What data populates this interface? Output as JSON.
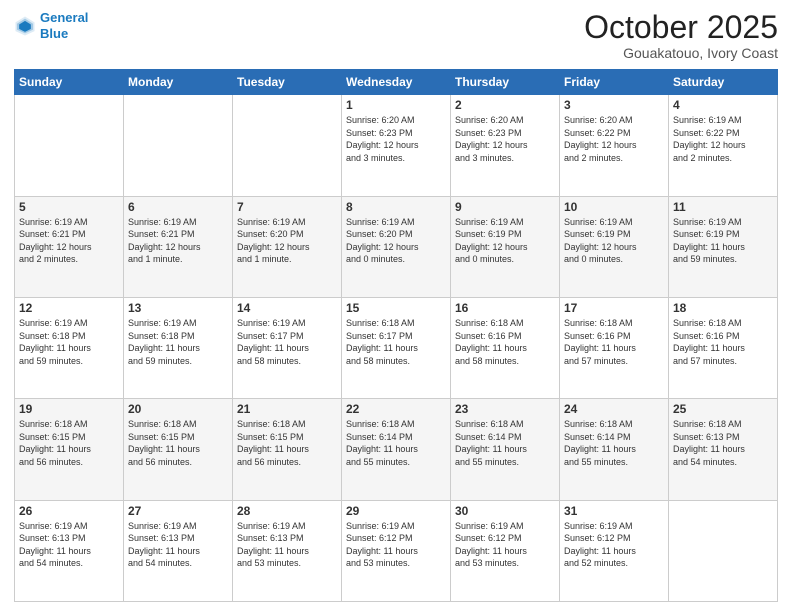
{
  "header": {
    "logo_line1": "General",
    "logo_line2": "Blue",
    "month": "October 2025",
    "location": "Gouakatouo, Ivory Coast"
  },
  "weekdays": [
    "Sunday",
    "Monday",
    "Tuesday",
    "Wednesday",
    "Thursday",
    "Friday",
    "Saturday"
  ],
  "weeks": [
    [
      {
        "day": "",
        "info": ""
      },
      {
        "day": "",
        "info": ""
      },
      {
        "day": "",
        "info": ""
      },
      {
        "day": "1",
        "info": "Sunrise: 6:20 AM\nSunset: 6:23 PM\nDaylight: 12 hours\nand 3 minutes."
      },
      {
        "day": "2",
        "info": "Sunrise: 6:20 AM\nSunset: 6:23 PM\nDaylight: 12 hours\nand 3 minutes."
      },
      {
        "day": "3",
        "info": "Sunrise: 6:20 AM\nSunset: 6:22 PM\nDaylight: 12 hours\nand 2 minutes."
      },
      {
        "day": "4",
        "info": "Sunrise: 6:19 AM\nSunset: 6:22 PM\nDaylight: 12 hours\nand 2 minutes."
      }
    ],
    [
      {
        "day": "5",
        "info": "Sunrise: 6:19 AM\nSunset: 6:21 PM\nDaylight: 12 hours\nand 2 minutes."
      },
      {
        "day": "6",
        "info": "Sunrise: 6:19 AM\nSunset: 6:21 PM\nDaylight: 12 hours\nand 1 minute."
      },
      {
        "day": "7",
        "info": "Sunrise: 6:19 AM\nSunset: 6:20 PM\nDaylight: 12 hours\nand 1 minute."
      },
      {
        "day": "8",
        "info": "Sunrise: 6:19 AM\nSunset: 6:20 PM\nDaylight: 12 hours\nand 0 minutes."
      },
      {
        "day": "9",
        "info": "Sunrise: 6:19 AM\nSunset: 6:19 PM\nDaylight: 12 hours\nand 0 minutes."
      },
      {
        "day": "10",
        "info": "Sunrise: 6:19 AM\nSunset: 6:19 PM\nDaylight: 12 hours\nand 0 minutes."
      },
      {
        "day": "11",
        "info": "Sunrise: 6:19 AM\nSunset: 6:19 PM\nDaylight: 11 hours\nand 59 minutes."
      }
    ],
    [
      {
        "day": "12",
        "info": "Sunrise: 6:19 AM\nSunset: 6:18 PM\nDaylight: 11 hours\nand 59 minutes."
      },
      {
        "day": "13",
        "info": "Sunrise: 6:19 AM\nSunset: 6:18 PM\nDaylight: 11 hours\nand 59 minutes."
      },
      {
        "day": "14",
        "info": "Sunrise: 6:19 AM\nSunset: 6:17 PM\nDaylight: 11 hours\nand 58 minutes."
      },
      {
        "day": "15",
        "info": "Sunrise: 6:18 AM\nSunset: 6:17 PM\nDaylight: 11 hours\nand 58 minutes."
      },
      {
        "day": "16",
        "info": "Sunrise: 6:18 AM\nSunset: 6:16 PM\nDaylight: 11 hours\nand 58 minutes."
      },
      {
        "day": "17",
        "info": "Sunrise: 6:18 AM\nSunset: 6:16 PM\nDaylight: 11 hours\nand 57 minutes."
      },
      {
        "day": "18",
        "info": "Sunrise: 6:18 AM\nSunset: 6:16 PM\nDaylight: 11 hours\nand 57 minutes."
      }
    ],
    [
      {
        "day": "19",
        "info": "Sunrise: 6:18 AM\nSunset: 6:15 PM\nDaylight: 11 hours\nand 56 minutes."
      },
      {
        "day": "20",
        "info": "Sunrise: 6:18 AM\nSunset: 6:15 PM\nDaylight: 11 hours\nand 56 minutes."
      },
      {
        "day": "21",
        "info": "Sunrise: 6:18 AM\nSunset: 6:15 PM\nDaylight: 11 hours\nand 56 minutes."
      },
      {
        "day": "22",
        "info": "Sunrise: 6:18 AM\nSunset: 6:14 PM\nDaylight: 11 hours\nand 55 minutes."
      },
      {
        "day": "23",
        "info": "Sunrise: 6:18 AM\nSunset: 6:14 PM\nDaylight: 11 hours\nand 55 minutes."
      },
      {
        "day": "24",
        "info": "Sunrise: 6:18 AM\nSunset: 6:14 PM\nDaylight: 11 hours\nand 55 minutes."
      },
      {
        "day": "25",
        "info": "Sunrise: 6:18 AM\nSunset: 6:13 PM\nDaylight: 11 hours\nand 54 minutes."
      }
    ],
    [
      {
        "day": "26",
        "info": "Sunrise: 6:19 AM\nSunset: 6:13 PM\nDaylight: 11 hours\nand 54 minutes."
      },
      {
        "day": "27",
        "info": "Sunrise: 6:19 AM\nSunset: 6:13 PM\nDaylight: 11 hours\nand 54 minutes."
      },
      {
        "day": "28",
        "info": "Sunrise: 6:19 AM\nSunset: 6:13 PM\nDaylight: 11 hours\nand 53 minutes."
      },
      {
        "day": "29",
        "info": "Sunrise: 6:19 AM\nSunset: 6:12 PM\nDaylight: 11 hours\nand 53 minutes."
      },
      {
        "day": "30",
        "info": "Sunrise: 6:19 AM\nSunset: 6:12 PM\nDaylight: 11 hours\nand 53 minutes."
      },
      {
        "day": "31",
        "info": "Sunrise: 6:19 AM\nSunset: 6:12 PM\nDaylight: 11 hours\nand 52 minutes."
      },
      {
        "day": "",
        "info": ""
      }
    ]
  ]
}
